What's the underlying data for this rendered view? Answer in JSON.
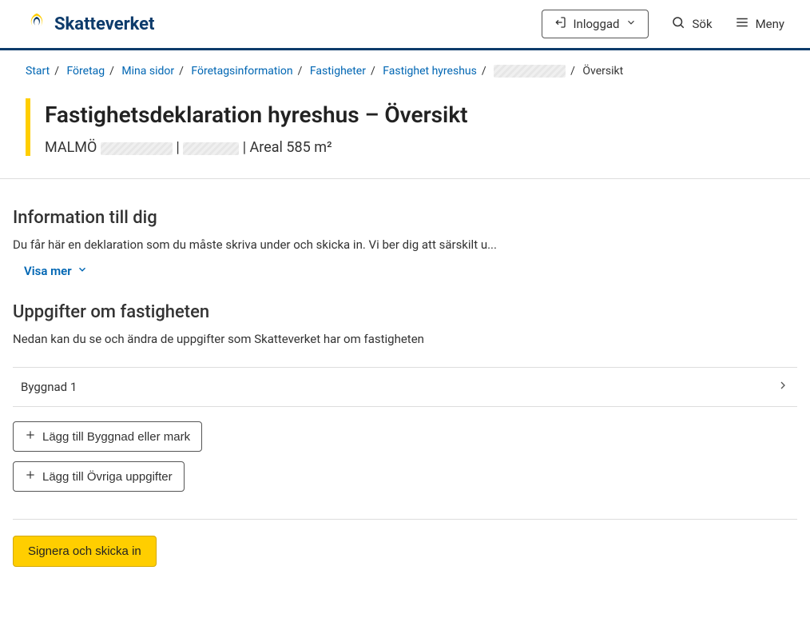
{
  "header": {
    "brand": "Skatteverket",
    "login_label": "Inloggad",
    "search_label": "Sök",
    "menu_label": "Meny"
  },
  "breadcrumb": {
    "items": [
      "Start",
      "Företag",
      "Mina sidor",
      "Företagsinformation",
      "Fastigheter",
      "Fastighet hyreshus"
    ],
    "current": "Översikt"
  },
  "title": "Fastighetsdeklaration hyreshus – Översikt",
  "subtitle_city": "MALMÖ",
  "subtitle_area_label": "Areal 585 m²",
  "info_section": {
    "heading": "Information till dig",
    "text": "Du får här en deklaration som du måste skriva under och skicka in. Vi ber dig att särskilt u...",
    "show_more": "Visa mer"
  },
  "details_section": {
    "heading": "Uppgifter om fastigheten",
    "text": "Nedan kan du se och ändra de uppgifter som Skatteverket har om fastigheten"
  },
  "list": {
    "items": [
      {
        "label": "Byggnad 1"
      }
    ]
  },
  "buttons": {
    "add_building": "Lägg till Byggnad eller mark",
    "add_other": "Lägg till Övriga uppgifter",
    "sign_submit": "Signera och skicka in"
  }
}
